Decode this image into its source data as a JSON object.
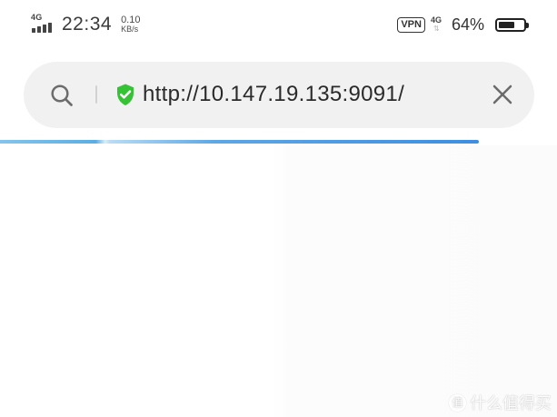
{
  "status_bar": {
    "network_label": "4G",
    "time": "22:34",
    "speed_value": "0.10",
    "speed_unit": "KB/s",
    "vpn_label": "VPN",
    "secondary_network_label": "4G",
    "battery_percent_text": "64%",
    "battery_level": 0.64
  },
  "address_bar": {
    "url": "http://10.147.19.135:9091/",
    "icons": {
      "search": "search-icon",
      "security": "shield-check-icon",
      "close": "close-icon"
    }
  },
  "page": {
    "loading_progress": 0.86
  },
  "watermark": {
    "badge": "值",
    "text": "什么值得买"
  },
  "colors": {
    "address_bar_bg": "#f1f1f2",
    "security_green": "#35c235",
    "progress_blue": "#3d8ee3",
    "text_dark": "#2a2a2a"
  }
}
